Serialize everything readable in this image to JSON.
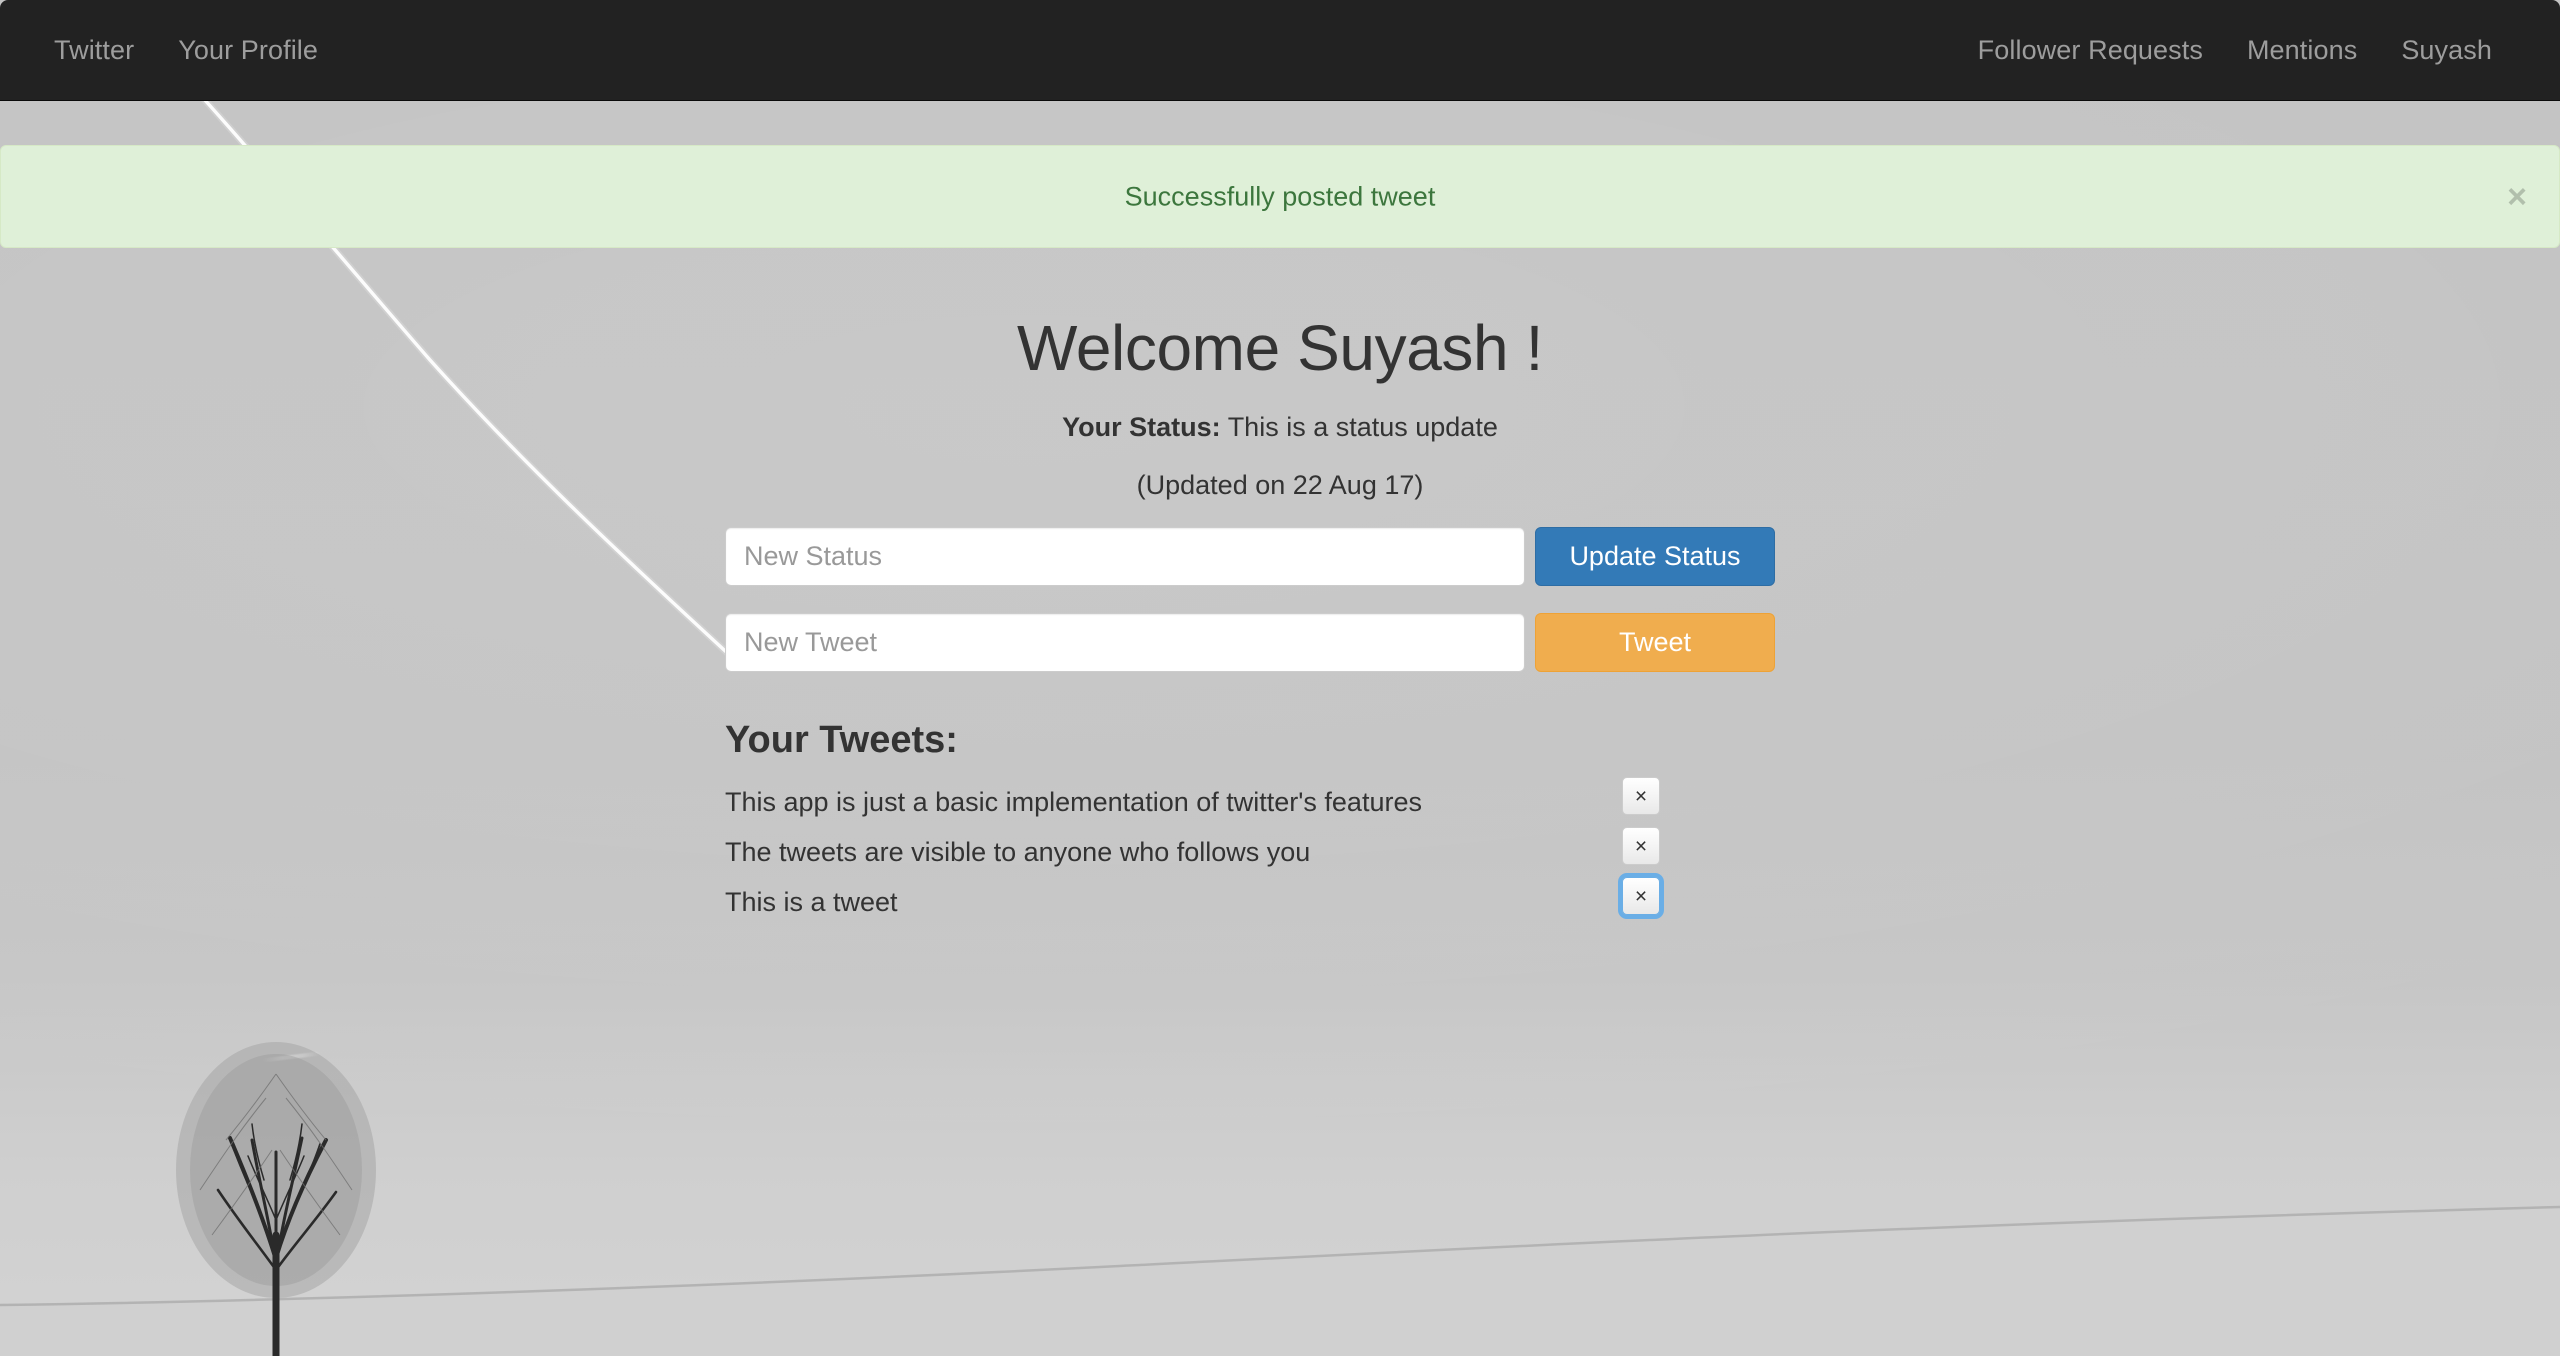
{
  "navbar": {
    "brand": "Twitter",
    "left_links": [
      {
        "label": "Twitter",
        "name": "nav-link-twitter"
      },
      {
        "label": "Your Profile",
        "name": "nav-link-your-profile"
      }
    ],
    "right_links": [
      {
        "label": "Follower Requests",
        "name": "nav-link-follower-requests"
      },
      {
        "label": "Mentions",
        "name": "nav-link-mentions"
      },
      {
        "label": "Suyash",
        "name": "nav-link-suyash"
      }
    ]
  },
  "alert": {
    "message": "Successfully posted tweet",
    "close_label": "×",
    "type": "success",
    "bg_color": "#dff0d8",
    "text_color": "#3c763d",
    "border_color": "#d6e9c6"
  },
  "main": {
    "heading": "Welcome Suyash !",
    "status_label": "Your Status:",
    "status_value": "This is a status update",
    "updated_text": "(Updated on 22 Aug 17)",
    "status_input": {
      "value": "",
      "placeholder": "New Status"
    },
    "tweet_input": {
      "value": "",
      "placeholder": "New Tweet"
    },
    "update_status_button": "Update Status",
    "tweet_button": "Tweet",
    "tweets_heading": "Your Tweets:",
    "tweets": [
      {
        "text": "This app is just a basic implementation of twitter's features",
        "delete_label": "×",
        "focused": false
      },
      {
        "text": "The tweets are visible to anyone who follows you",
        "delete_label": "×",
        "focused": false
      },
      {
        "text": "This is a tweet",
        "delete_label": "×",
        "focused": true
      }
    ]
  },
  "theme": {
    "navbar_bg": "#222222",
    "navbar_link": "#9d9d9d",
    "primary_button": "#337ab7",
    "warning_button": "#f0ad4e",
    "focus_ring": "#66afe9",
    "text": "#333333"
  }
}
